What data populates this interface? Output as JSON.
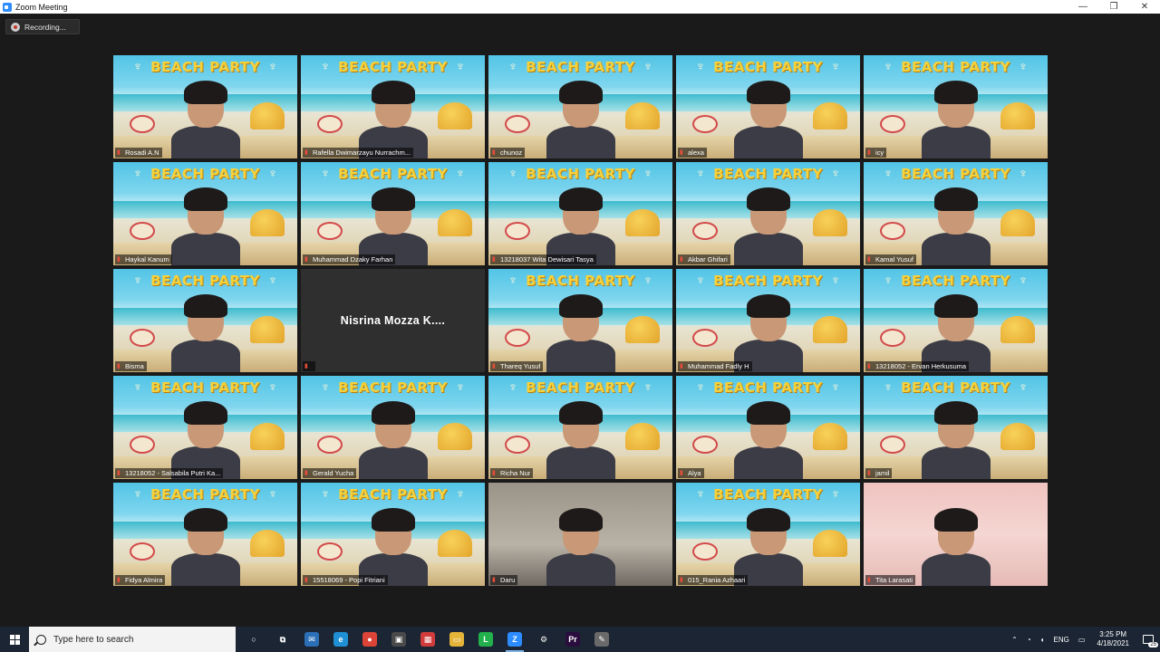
{
  "window": {
    "title": "Zoom Meeting",
    "controls": {
      "minimize": "—",
      "restore": "❐",
      "close": "✕"
    }
  },
  "recording": {
    "label": "Recording..."
  },
  "tile_banner": "BEACH PARTY",
  "participants": [
    {
      "name": "Rosadi A.N",
      "bg": "beach"
    },
    {
      "name": "Rafella Dwimarzayu Nurrachm...",
      "bg": "beach"
    },
    {
      "name": "chunoz",
      "bg": "beach",
      "active": true
    },
    {
      "name": "alexa",
      "bg": "beach"
    },
    {
      "name": "icy",
      "bg": "beach"
    },
    {
      "name": "Haykal Kanum",
      "bg": "beach"
    },
    {
      "name": "Muhammad Dzaky Farhan",
      "bg": "beach"
    },
    {
      "name": "13218037 Wita Dewisari Tasya",
      "bg": "beach"
    },
    {
      "name": "Akbar Ghifari",
      "bg": "beach"
    },
    {
      "name": "Kamal Yusuf",
      "bg": "beach"
    },
    {
      "name": "Bisma",
      "bg": "beach"
    },
    {
      "name": "",
      "bg": "plain",
      "display_name": "Nisrina  Mozza  K...."
    },
    {
      "name": "Thareq Yusuf",
      "bg": "beach"
    },
    {
      "name": "Muhammad Fadly H",
      "bg": "beach"
    },
    {
      "name": "13218052 - Ervan Herkusuma",
      "bg": "beach"
    },
    {
      "name": "13218052 - Salsabila Putri Ka...",
      "bg": "beach"
    },
    {
      "name": "Gerald Yucha",
      "bg": "beach"
    },
    {
      "name": "Richa Nur",
      "bg": "beach"
    },
    {
      "name": "Alya",
      "bg": "beach"
    },
    {
      "name": "jamil",
      "bg": "beach"
    },
    {
      "name": "Fidya Almira",
      "bg": "beach"
    },
    {
      "name": "15518069 - Popi Fitriani",
      "bg": "beach"
    },
    {
      "name": "Daru",
      "bg": "room"
    },
    {
      "name": "015_Rania Azhaari",
      "bg": "beach"
    },
    {
      "name": "Tita Larasati",
      "bg": "pink"
    }
  ],
  "taskbar": {
    "search_placeholder": "Type here to search",
    "lang": "ENG",
    "time": "3:25 PM",
    "date": "4/18/2021",
    "notification_count": "25",
    "apps": [
      {
        "icon": "cortana-icon",
        "glyph": "○",
        "color": "transparent"
      },
      {
        "icon": "task-view-icon",
        "glyph": "⧉",
        "color": "transparent"
      },
      {
        "icon": "mail-icon",
        "glyph": "✉",
        "color": "#2b6fb6"
      },
      {
        "icon": "edge-icon",
        "glyph": "e",
        "color": "#1f8fd6"
      },
      {
        "icon": "chrome-icon",
        "glyph": "●",
        "color": "#db4437"
      },
      {
        "icon": "store-icon",
        "glyph": "▣",
        "color": "#4a4a4a"
      },
      {
        "icon": "gift-icon",
        "glyph": "▦",
        "color": "#d23b3b"
      },
      {
        "icon": "file-explorer-icon",
        "glyph": "▭",
        "color": "#e5b53a"
      },
      {
        "icon": "line-icon",
        "glyph": "L",
        "color": "#22b14c"
      },
      {
        "icon": "zoom-icon",
        "glyph": "Z",
        "color": "#2d8cff",
        "active": true
      },
      {
        "icon": "settings-icon",
        "glyph": "⚙",
        "color": "transparent"
      },
      {
        "icon": "premiere-icon",
        "glyph": "Pr",
        "color": "#2a0d3d"
      },
      {
        "icon": "paint-icon",
        "glyph": "✎",
        "color": "#6a6a6a"
      }
    ]
  }
}
